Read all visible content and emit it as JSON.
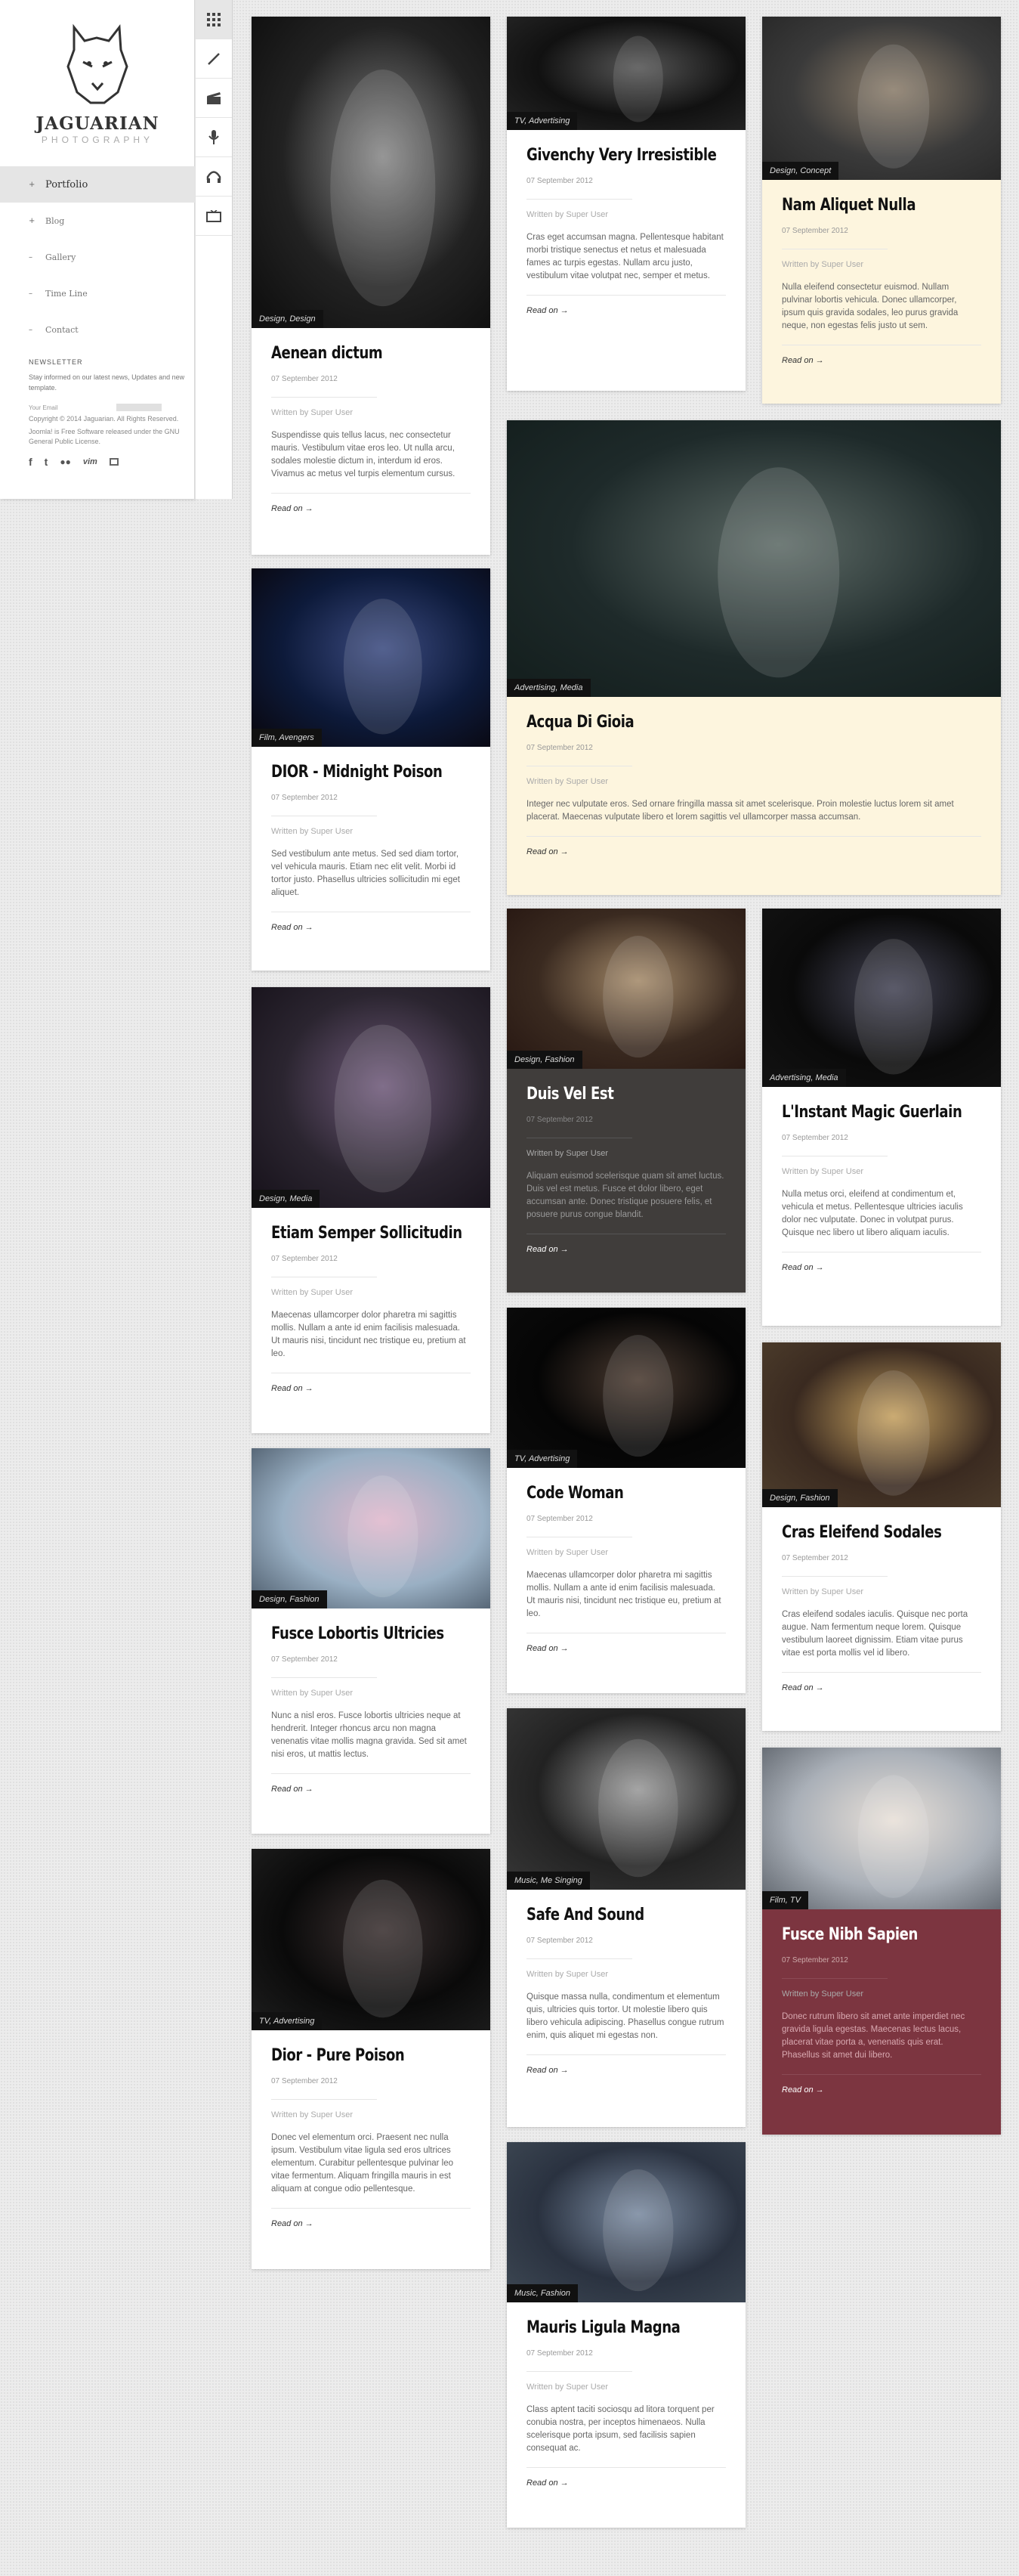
{
  "brand": {
    "name": "JAGUARIAN",
    "tagline": "PHOTOGRAPHY"
  },
  "nav": [
    {
      "label": "Portfolio",
      "marker": "+",
      "active": true
    },
    {
      "label": "Blog",
      "marker": "+"
    },
    {
      "label": "Gallery",
      "marker": "–"
    },
    {
      "label": "Time Line",
      "marker": "–"
    },
    {
      "label": "Contact",
      "marker": "–"
    }
  ],
  "iconbar": [
    "grid-icon",
    "brush-icon",
    "film-clapper-icon",
    "microphone-icon",
    "headphones-icon",
    "tv-icon"
  ],
  "newsletter": {
    "title": "NEWSLETTER",
    "text": "Stay informed on our latest news, Updates and new template.",
    "field_label": "Your Email",
    "copyright": "Copyright © 2014 Jaguarian. All Rights Reserved.",
    "license": "Joomla! is Free Software released under the GNU General Public License."
  },
  "social": [
    "facebook-icon",
    "twitter-icon",
    "flickr-icon",
    "vimeo-icon",
    "rss-icon"
  ],
  "read_on": "Read on →",
  "author": "Written by Super User",
  "posts": [
    {
      "title": "Aenean dictum",
      "category": "Design, Design",
      "date": "07 September 2012",
      "excerpt": "Suspendisse quis tellus lacus, nec consectetur mauris. Vestibulum vitae eros leo. Ut nulla arcu, sodales molestie dictum in, interdum id eros. Vivamus ac metus vel turpis elementum cursus."
    },
    {
      "title": "Givenchy Very Irresistible",
      "category": "TV, Advertising",
      "date": "07 September 2012",
      "excerpt": "Cras eget accumsan magna. Pellentesque habitant morbi tristique senectus et netus et malesuada fames ac turpis egestas. Nullam arcu justo, vestibulum vitae volutpat nec, semper et metus."
    },
    {
      "title": "Nam Aliquet Nulla",
      "category": "Design, Concept",
      "date": "07 September 2012",
      "excerpt": "Nulla eleifend consectetur euismod. Nullam pulvinar lobortis vehicula. Donec ullamcorper, ipsum quis gravida sodales, leo purus gravida neque, non egestas felis justo ut sem."
    },
    {
      "title": "Acqua Di Gioia",
      "category": "Advertising, Media",
      "date": "07 September 2012",
      "excerpt": "Integer nec vulputate eros. Sed ornare fringilla massa sit amet scelerisque. Proin molestie luctus lorem sit amet placerat. Maecenas vulputate libero et lorem sagittis vel ullamcorper massa accumsan."
    },
    {
      "title": "DIOR - Midnight Poison",
      "category": "Film, Avengers",
      "date": "07 September 2012",
      "excerpt": "Sed vestibulum ante metus. Sed sed diam tortor, vel vehicula mauris. Etiam nec elit velit. Morbi id tortor justo. Phasellus ultricies sollicitudin mi eget aliquet."
    },
    {
      "title": "Duis Vel Est",
      "category": "Design, Fashion",
      "date": "07 September 2012",
      "excerpt": "Aliquam euismod scelerisque quam sit amet luctus. Duis vel est metus. Fusce et dolor libero, eget accumsan ante. Donec tristique posuere felis, et posuere purus congue blandit."
    },
    {
      "title": "L'Instant Magic Guerlain",
      "category": "Advertising, Media",
      "date": "07 September 2012",
      "excerpt": "Nulla metus orci, eleifend at condimentum et, vehicula et metus. Pellentesque ultricies iaculis dolor nec vulputate. Donec in volutpat purus. Quisque nec libero ut libero aliquam iaculis."
    },
    {
      "title": "Etiam Semper Sollicitudin",
      "category": "Design, Media",
      "date": "07 September 2012",
      "excerpt": "Maecenas ullamcorper dolor pharetra mi sagittis mollis. Nullam a ante id enim facilisis malesuada. Ut mauris nisi, tincidunt nec tristique eu, pretium at leo."
    },
    {
      "title": "Code Woman",
      "category": "TV, Advertising",
      "date": "07 September 2012",
      "excerpt": "Maecenas ullamcorper dolor pharetra mi sagittis mollis. Nullam a ante id enim facilisis malesuada. Ut mauris nisi, tincidunt nec tristique eu, pretium at leo."
    },
    {
      "title": "Cras Eleifend Sodales",
      "category": "Design, Fashion",
      "date": "07 September 2012",
      "excerpt": "Cras eleifend sodales iaculis. Quisque nec porta augue. Nam fermentum neque lorem. Quisque vestibulum laoreet dignissim. Etiam vitae purus vitae est porta mollis vel id libero."
    },
    {
      "title": "Fusce Lobortis Ultricies",
      "category": "Design, Fashion",
      "date": "07 September 2012",
      "excerpt": "Nunc a nisl eros. Fusce lobortis ultricies neque at hendrerit. Integer rhoncus arcu non magna venenatis vitae mollis magna gravida. Sed sit amet nisi eros, ut mattis lectus."
    },
    {
      "title": "Safe And Sound",
      "category": "Music, Me Singing",
      "date": "07 September 2012",
      "excerpt": "Quisque massa nulla, condimentum et elementum quis, ultricies quis tortor. Ut molestie libero quis libero vehicula adipiscing. Phasellus congue rutrum enim, quis aliquet mi egestas non."
    },
    {
      "title": "Fusce Nibh Sapien",
      "category": "Film, TV",
      "date": "07 September 2012",
      "excerpt": "Donec rutrum libero sit amet ante imperdiet nec gravida ligula egestas. Maecenas lectus lacus, placerat vitae porta a, venenatis quis erat. Phasellus sit amet dui libero."
    },
    {
      "title": "Dior - Pure Poison",
      "category": "TV, Advertising",
      "date": "07 September 2012",
      "excerpt": "Donec vel elementum orci. Praesent nec nulla ipsum. Vestibulum vitae ligula sed eros ultrices elementum. Curabitur pellentesque pulvinar leo vitae fermentum. Aliquam fringilla mauris in est aliquam at congue odio pellentesque."
    },
    {
      "title": "Mauris Ligula Magna",
      "category": "Music, Fashion",
      "date": "07 September 2012",
      "excerpt": "Class aptent taciti sociosqu ad litora torquent per conubia nostra, per inceptos himenaeos. Nulla scelerisque porta ipsum, sed facilisis sapien consequat ac."
    }
  ]
}
